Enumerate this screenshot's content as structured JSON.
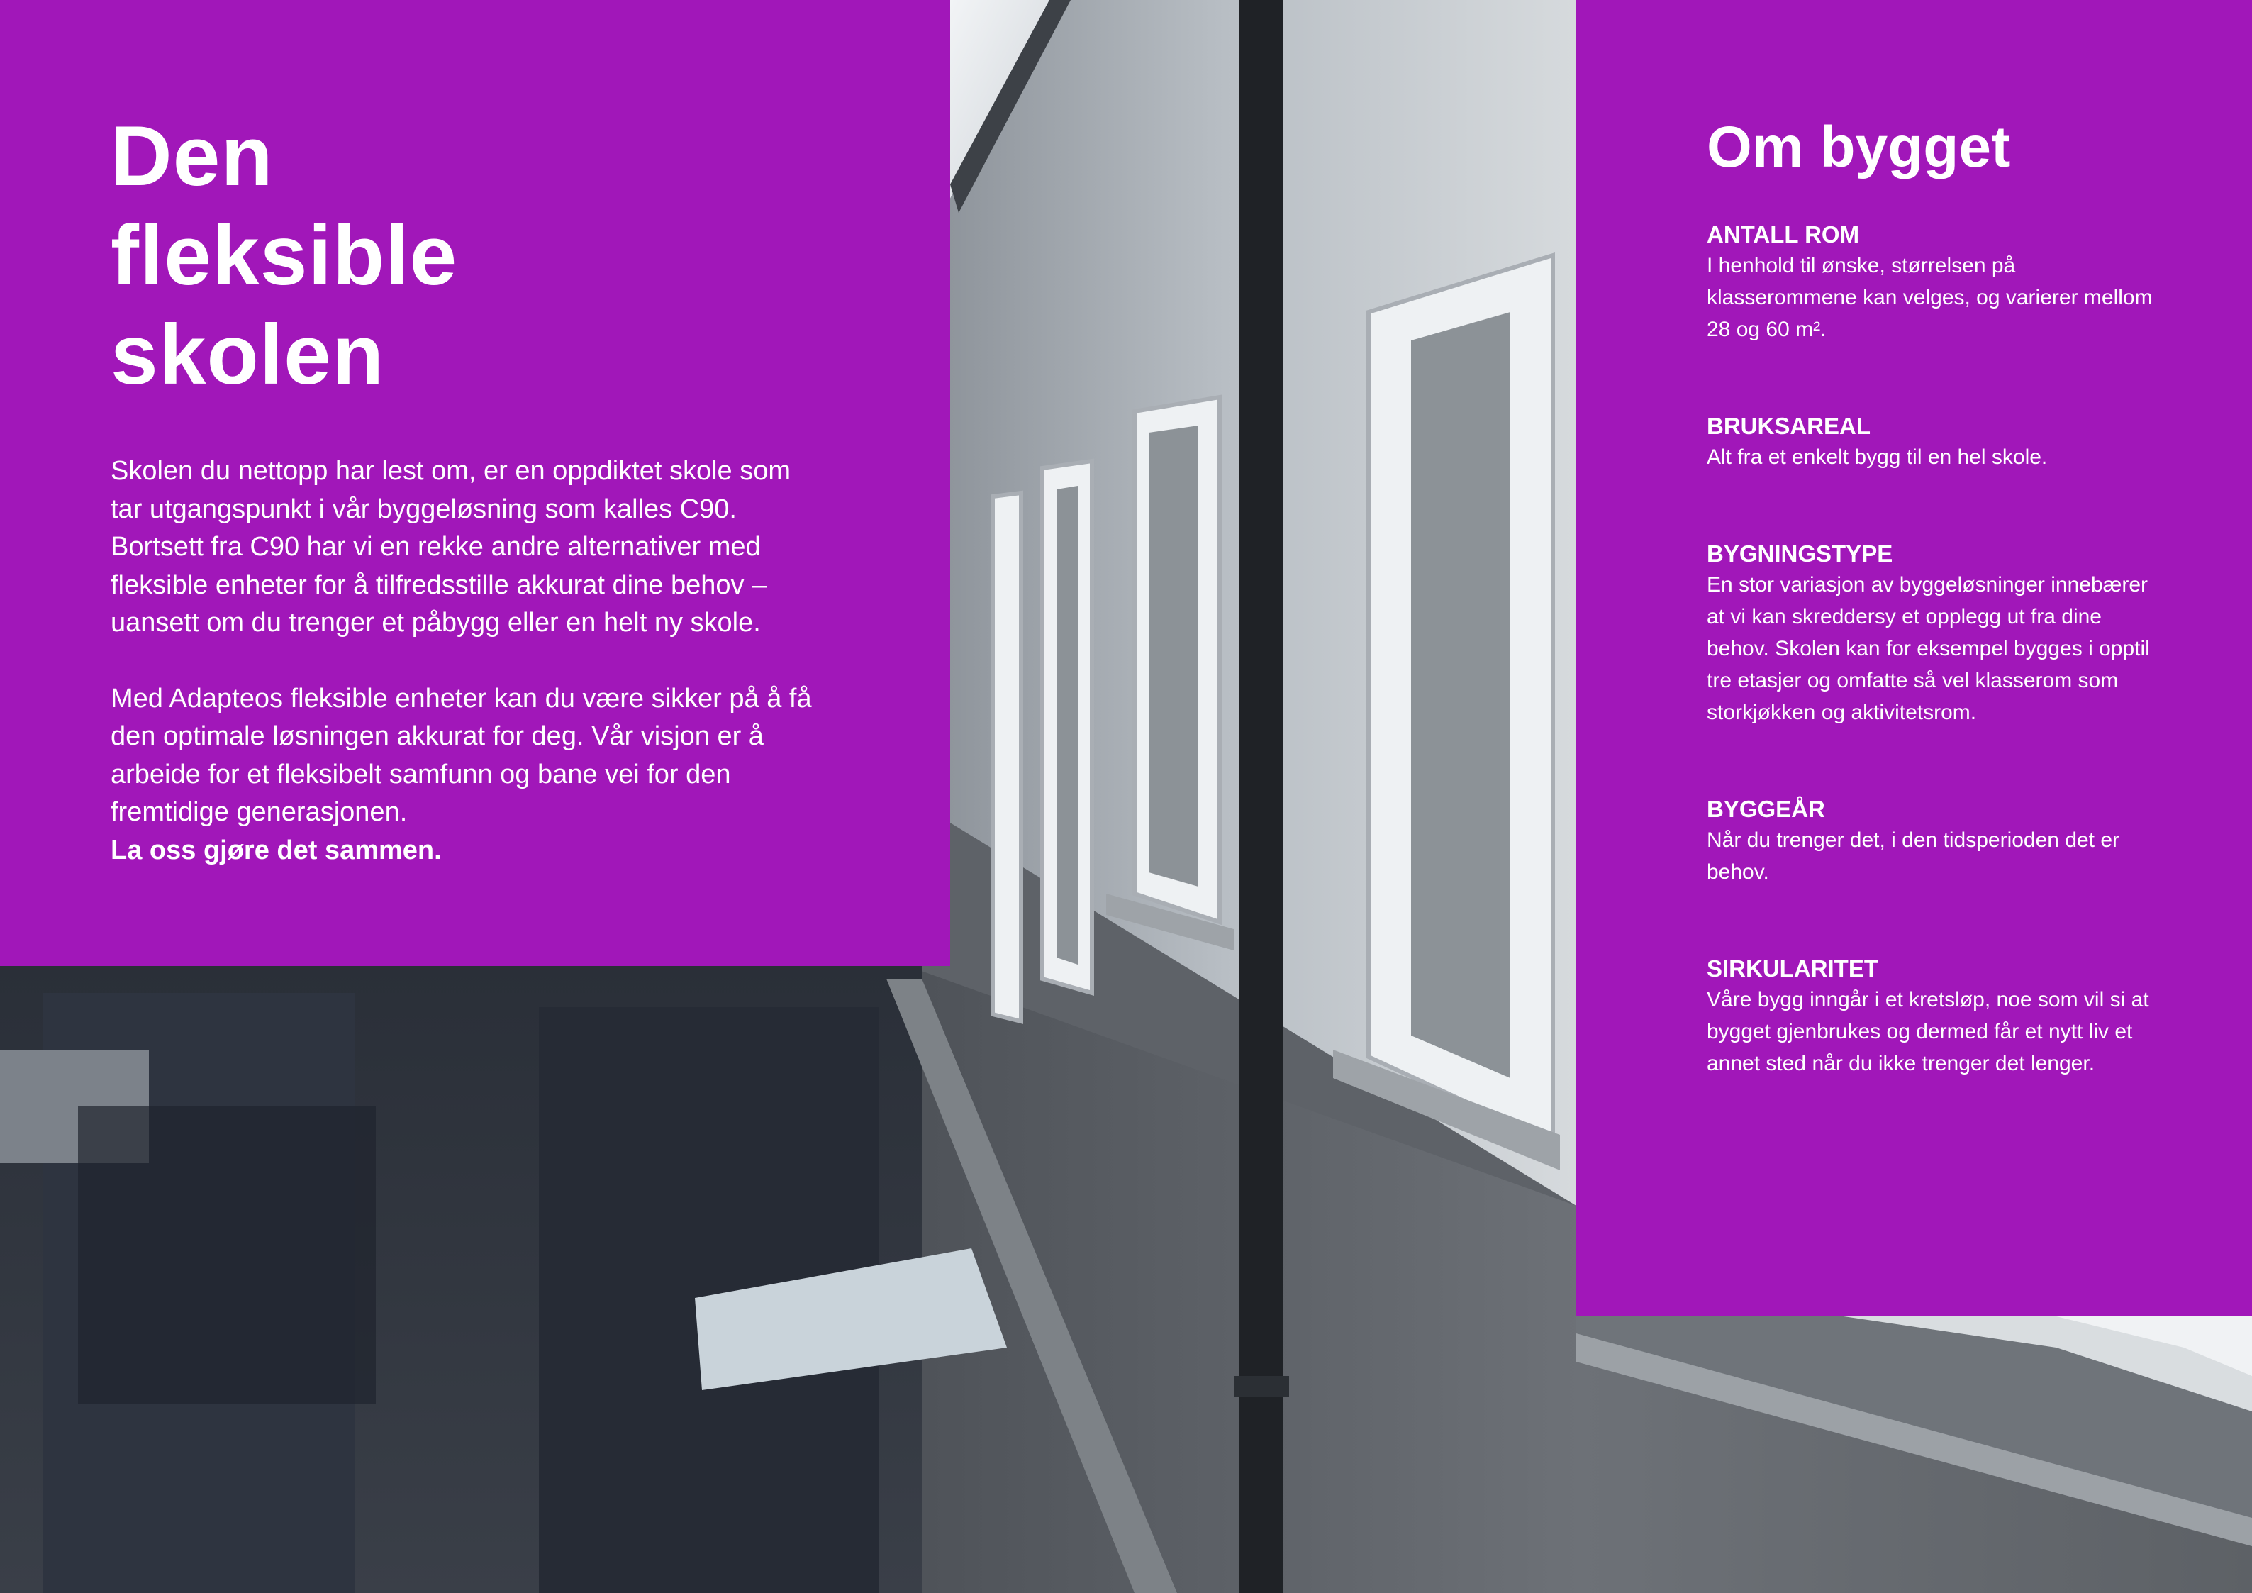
{
  "left": {
    "headline": [
      "Den",
      "fleksible",
      "skolen"
    ],
    "paragraph1": "Skolen du nettopp har lest om, er en oppdiktet skole som tar utgangspunkt i vår byggeløsning som kalles C90. Bortsett fra C90 har vi en rekke andre alternativer med fleksible enheter for å tilfredsstille akkurat dine behov – uansett om du trenger et påbygg eller en helt ny skole.",
    "paragraph2": "Med Adapteos fleksible enheter kan du være sikker på å få den optimale løsningen akkurat for deg. Vår visjon er å arbeide for et fleksibelt samfunn og bane vei for den fremtidige generasjonen.",
    "cta": "La oss gjøre det sammen."
  },
  "right": {
    "title": "Om bygget",
    "facts": [
      {
        "label": "ANTALL ROM",
        "text": "I henhold til ønske, størrelsen på klasserommene kan velges, og varierer mellom 28 og 60 m²."
      },
      {
        "label": "BRUKSAREAL",
        "text": "Alt fra et enkelt bygg til en hel skole."
      },
      {
        "label": "BYGNINGSTYPE",
        "text": "En stor variasjon av byggeløsninger innebærer at vi kan skreddersy et opplegg ut fra dine behov. Skolen kan for eksempel bygges i opptil tre etasjer og omfatte så vel klasserom som storkjøkken og aktivitetsrom."
      },
      {
        "label": "BYGGEÅR",
        "text": "Når du trenger det, i den tidsperioden det er behov."
      },
      {
        "label": "SIRKULARITET",
        "text": "Våre bygg inngår i et kretsløp, noe som vil si at bygget gjenbrukes og dermed får et nytt liv et annet sted når du ikke trenger det lenger."
      }
    ]
  },
  "colors": {
    "panel": "#a117b9",
    "text": "#ffffff"
  }
}
